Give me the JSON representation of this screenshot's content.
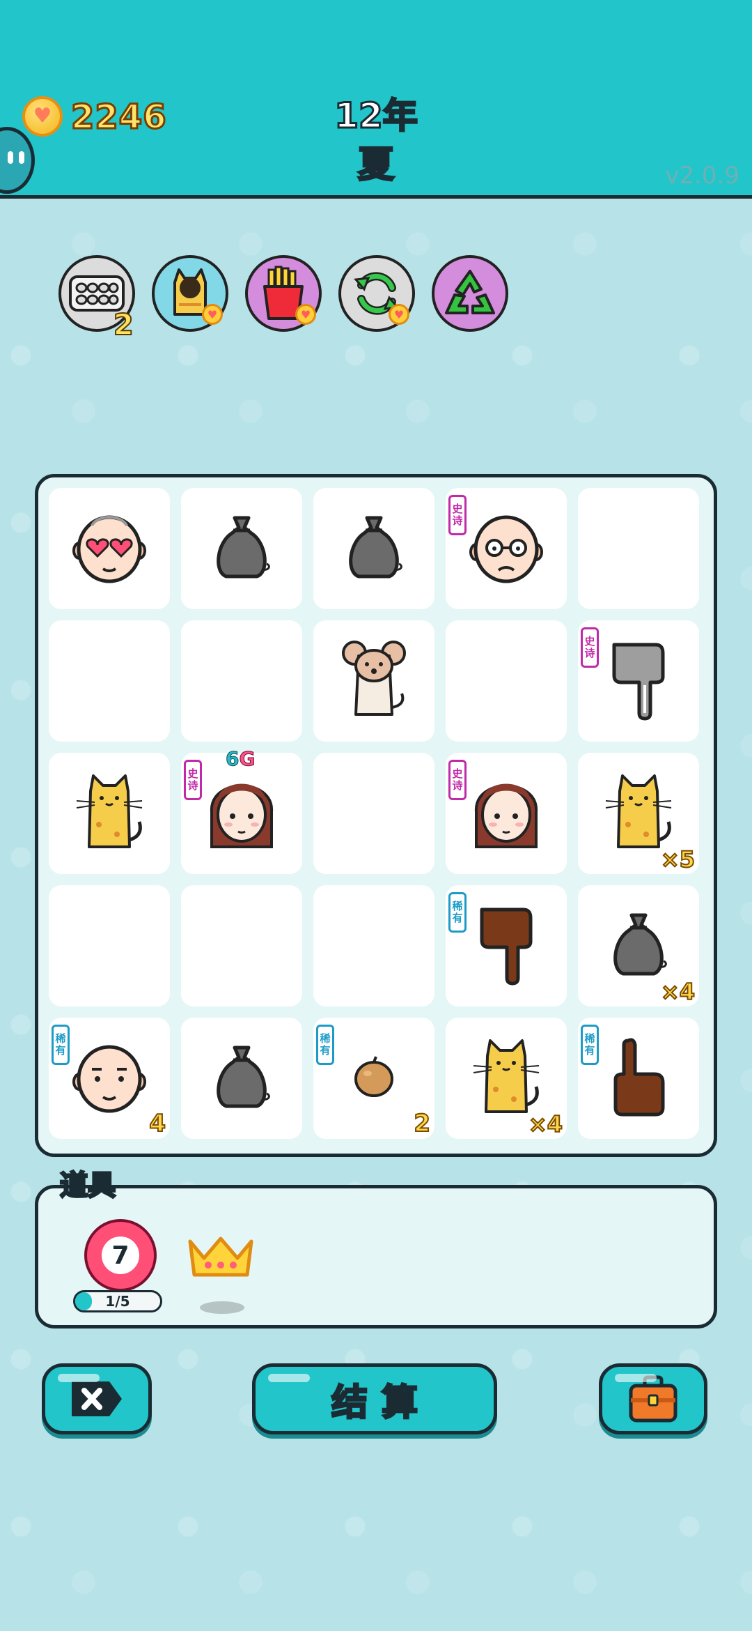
{
  "header": {
    "coins": "2246",
    "year": "12年",
    "season": "夏",
    "version": "v2.0.9"
  },
  "skills": [
    {
      "name": "egg-tray",
      "count": "2",
      "bg": "#d9d9d9"
    },
    {
      "name": "cat-hole",
      "count": "",
      "bg": "#7fd7e6"
    },
    {
      "name": "fries",
      "count": "",
      "bg": "#d08ad8"
    },
    {
      "name": "refresh",
      "count": "",
      "bg": "#d9d9d9"
    },
    {
      "name": "recycle",
      "count": "",
      "bg": "#d08ad8"
    }
  ],
  "tags": {
    "epic": [
      "史",
      "诗"
    ],
    "rare": [
      "稀",
      "有"
    ]
  },
  "board": {
    "rows": [
      [
        {
          "icon": "heart-eyes-old-man",
          "tag": "",
          "mult": "",
          "count": ""
        },
        {
          "icon": "garbage-bag",
          "tag": "",
          "mult": "",
          "count": ""
        },
        {
          "icon": "garbage-bag",
          "tag": "",
          "mult": "",
          "count": ""
        },
        {
          "icon": "old-man-glasses",
          "tag": "epic",
          "mult": "",
          "count": ""
        },
        {
          "icon": "",
          "tag": "",
          "mult": "",
          "count": ""
        }
      ],
      [
        {
          "icon": "",
          "tag": "",
          "mult": "",
          "count": ""
        },
        {
          "icon": "",
          "tag": "",
          "mult": "",
          "count": ""
        },
        {
          "icon": "mouse",
          "tag": "",
          "mult": "",
          "count": ""
        },
        {
          "icon": "",
          "tag": "",
          "mult": "",
          "count": ""
        },
        {
          "icon": "gray-pointing-hand",
          "tag": "epic",
          "mult": "",
          "count": ""
        }
      ],
      [
        {
          "icon": "yellow-cat",
          "tag": "",
          "mult": "",
          "count": ""
        },
        {
          "icon": "girl-braids",
          "tag": "epic",
          "mult": "",
          "count": "",
          "topmark": "6",
          "topmark2": "G"
        },
        {
          "icon": "",
          "tag": "",
          "mult": "",
          "count": ""
        },
        {
          "icon": "girl-braids",
          "tag": "epic",
          "mult": "",
          "count": ""
        },
        {
          "icon": "yellow-cat",
          "tag": "",
          "mult": "×5",
          "count": ""
        }
      ],
      [
        {
          "icon": "",
          "tag": "",
          "mult": "",
          "count": ""
        },
        {
          "icon": "",
          "tag": "",
          "mult": "",
          "count": ""
        },
        {
          "icon": "",
          "tag": "",
          "mult": "",
          "count": ""
        },
        {
          "icon": "brown-pointing-hand",
          "tag": "rare",
          "mult": "",
          "count": ""
        },
        {
          "icon": "garbage-bag",
          "tag": "",
          "mult": "×4",
          "count": ""
        }
      ],
      [
        {
          "icon": "bald-man",
          "tag": "rare",
          "mult": "",
          "count": "4"
        },
        {
          "icon": "garbage-bag",
          "tag": "",
          "mult": "",
          "count": ""
        },
        {
          "icon": "potato",
          "tag": "rare",
          "mult": "",
          "count": "2"
        },
        {
          "icon": "yellow-cat",
          "tag": "",
          "mult": "×4",
          "count": ""
        },
        {
          "icon": "brown-up-hand",
          "tag": "rare",
          "mult": "",
          "count": ""
        }
      ]
    ]
  },
  "items": {
    "title": "道具",
    "dart_count": "7",
    "dart_progress_label": "1/5",
    "dart_progress": 0.2
  },
  "buttons": {
    "settle": "结算"
  },
  "colors": {
    "teal": "#22c5c9",
    "outline": "#1b2b33",
    "epic": "#c02aa8",
    "rare": "#1d9bc7",
    "gold": "#ffd84a"
  }
}
